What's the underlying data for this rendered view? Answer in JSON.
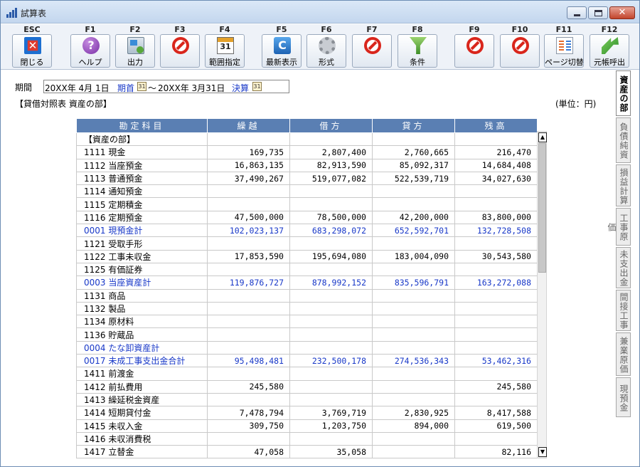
{
  "window": {
    "title": "試算表"
  },
  "toolbar": [
    {
      "key": "ESC",
      "label": "閉じる",
      "icon": "exit-icon"
    },
    {
      "key": "F1",
      "label": "ヘルプ",
      "icon": "help-icon"
    },
    {
      "key": "F2",
      "label": "出力",
      "icon": "output-icon"
    },
    {
      "key": "F3",
      "label": "",
      "icon": "prohibit-icon"
    },
    {
      "key": "F4",
      "label": "範囲指定",
      "icon": "calendar-icon",
      "icon_text": "31"
    },
    {
      "key": "F5",
      "label": "最新表示",
      "icon": "refresh-icon",
      "icon_text": "C"
    },
    {
      "key": "F6",
      "label": "形式",
      "icon": "gear-icon"
    },
    {
      "key": "F7",
      "label": "",
      "icon": "prohibit-icon"
    },
    {
      "key": "F8",
      "label": "条件",
      "icon": "filter-icon"
    },
    {
      "key": "F9",
      "label": "",
      "icon": "prohibit-icon"
    },
    {
      "key": "F10",
      "label": "",
      "icon": "prohibit-icon"
    },
    {
      "key": "F11",
      "label": "ページ切替",
      "icon": "pages-icon"
    },
    {
      "key": "F12",
      "label": "元帳呼出",
      "icon": "ledger-icon"
    }
  ],
  "period": {
    "label": "期間",
    "from": "20XX年  4月  1日",
    "from_link": "期首",
    "separator": "～",
    "to": "20XX年  3月31日",
    "to_link": "決算",
    "cal_icon_text": "31"
  },
  "section_title": "【貸借対照表  資産の部】",
  "unit": "(単位：円)",
  "table": {
    "headers": [
      "勘定科目",
      "繰越",
      "借方",
      "貸方",
      "残高"
    ],
    "rows": [
      {
        "code": "",
        "name": "【資産の部】",
        "carry": "",
        "debit": "",
        "credit": "",
        "balance": "",
        "total": false
      },
      {
        "code": "1111",
        "name": "現金",
        "carry": "169,735",
        "debit": "2,807,400",
        "credit": "2,760,665",
        "balance": "216,470",
        "total": false
      },
      {
        "code": "1112",
        "name": "当座預金",
        "carry": "16,863,135",
        "debit": "82,913,590",
        "credit": "85,092,317",
        "balance": "14,684,408",
        "total": false
      },
      {
        "code": "1113",
        "name": "普通預金",
        "carry": "37,490,267",
        "debit": "519,077,082",
        "credit": "522,539,719",
        "balance": "34,027,630",
        "total": false
      },
      {
        "code": "1114",
        "name": "通知預金",
        "carry": "",
        "debit": "",
        "credit": "",
        "balance": "",
        "total": false
      },
      {
        "code": "1115",
        "name": "定期積金",
        "carry": "",
        "debit": "",
        "credit": "",
        "balance": "",
        "total": false
      },
      {
        "code": "1116",
        "name": "定期預金",
        "carry": "47,500,000",
        "debit": "78,500,000",
        "credit": "42,200,000",
        "balance": "83,800,000",
        "total": false
      },
      {
        "code": "0001",
        "name": "現預金計",
        "carry": "102,023,137",
        "debit": "683,298,072",
        "credit": "652,592,701",
        "balance": "132,728,508",
        "total": true
      },
      {
        "code": "1121",
        "name": "受取手形",
        "carry": "",
        "debit": "",
        "credit": "",
        "balance": "",
        "total": false
      },
      {
        "code": "1122",
        "name": "工事未収金",
        "carry": "17,853,590",
        "debit": "195,694,080",
        "credit": "183,004,090",
        "balance": "30,543,580",
        "total": false
      },
      {
        "code": "1125",
        "name": "有価証券",
        "carry": "",
        "debit": "",
        "credit": "",
        "balance": "",
        "total": false
      },
      {
        "code": "0003",
        "name": "当座資産計",
        "carry": "119,876,727",
        "debit": "878,992,152",
        "credit": "835,596,791",
        "balance": "163,272,088",
        "total": true
      },
      {
        "code": "1131",
        "name": "商品",
        "carry": "",
        "debit": "",
        "credit": "",
        "balance": "",
        "total": false
      },
      {
        "code": "1132",
        "name": "製品",
        "carry": "",
        "debit": "",
        "credit": "",
        "balance": "",
        "total": false
      },
      {
        "code": "1134",
        "name": "原材料",
        "carry": "",
        "debit": "",
        "credit": "",
        "balance": "",
        "total": false
      },
      {
        "code": "1136",
        "name": "貯蔵品",
        "carry": "",
        "debit": "",
        "credit": "",
        "balance": "",
        "total": false
      },
      {
        "code": "0004",
        "name": "たな卸資産計",
        "carry": "",
        "debit": "",
        "credit": "",
        "balance": "",
        "total": true
      },
      {
        "code": "0017",
        "name": "未成工事支出金合計",
        "carry": "95,498,481",
        "debit": "232,500,178",
        "credit": "274,536,343",
        "balance": "53,462,316",
        "total": true
      },
      {
        "code": "1411",
        "name": "前渡金",
        "carry": "",
        "debit": "",
        "credit": "",
        "balance": "",
        "total": false
      },
      {
        "code": "1412",
        "name": "前払費用",
        "carry": "245,580",
        "debit": "",
        "credit": "",
        "balance": "245,580",
        "total": false
      },
      {
        "code": "1413",
        "name": "繰延税金資産",
        "carry": "",
        "debit": "",
        "credit": "",
        "balance": "",
        "total": false
      },
      {
        "code": "1414",
        "name": "短期貸付金",
        "carry": "7,478,794",
        "debit": "3,769,719",
        "credit": "2,830,925",
        "balance": "8,417,588",
        "total": false
      },
      {
        "code": "1415",
        "name": "未収入金",
        "carry": "309,750",
        "debit": "1,203,750",
        "credit": "894,000",
        "balance": "619,500",
        "total": false
      },
      {
        "code": "1416",
        "name": "未収消費税",
        "carry": "",
        "debit": "",
        "credit": "",
        "balance": "",
        "total": false
      },
      {
        "code": "1417",
        "name": "立替金",
        "carry": "47,058",
        "debit": "35,058",
        "credit": "",
        "balance": "82,116",
        "total": false
      }
    ]
  },
  "side_tabs": [
    {
      "label": "資産の部",
      "active": true
    },
    {
      "label": "負債純資",
      "active": false
    },
    {
      "label": "損益計算",
      "active": false
    },
    {
      "label": "工事原価",
      "active": false
    },
    {
      "label": "未支出金",
      "active": false
    },
    {
      "label": "間接工事",
      "active": false
    },
    {
      "label": "兼業原価",
      "active": false
    },
    {
      "label": "現預金",
      "active": false
    }
  ],
  "scrollbar": {
    "up_glyph": "▲",
    "down_glyph": "▼"
  }
}
